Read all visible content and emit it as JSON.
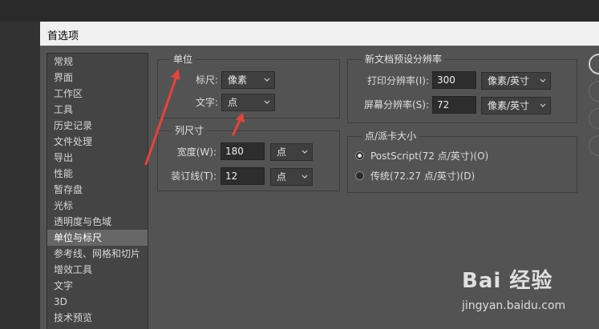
{
  "dialog": {
    "title": "首选项"
  },
  "sidebar": {
    "items": [
      {
        "label": "常规"
      },
      {
        "label": "界面"
      },
      {
        "label": "工作区"
      },
      {
        "label": "工具"
      },
      {
        "label": "历史记录"
      },
      {
        "label": "文件处理"
      },
      {
        "label": "导出"
      },
      {
        "label": "性能"
      },
      {
        "label": "暂存盘"
      },
      {
        "label": "光标"
      },
      {
        "label": "透明度与色域"
      },
      {
        "label": "单位与标尺"
      },
      {
        "label": "参考线、网格和切片"
      },
      {
        "label": "增效工具"
      },
      {
        "label": "文字"
      },
      {
        "label": "3D"
      },
      {
        "label": "技术预览"
      }
    ],
    "active_label": "单位与标尺"
  },
  "units": {
    "title": "单位",
    "ruler_label": "标尺:",
    "ruler_value": "像素",
    "type_label": "文字:",
    "type_value": "点"
  },
  "column_size": {
    "title": "列尺寸",
    "width_label": "宽度(W):",
    "width_value": "180",
    "width_unit": "点",
    "gutter_label": "装订线(T):",
    "gutter_value": "12",
    "gutter_unit": "点"
  },
  "new_doc_resolution": {
    "title": "新文档预设分辨率",
    "print_label": "打印分辨率(I):",
    "print_value": "300",
    "print_unit": "像素/英寸",
    "screen_label": "屏幕分辨率(S):",
    "screen_value": "72",
    "screen_unit": "像素/英寸"
  },
  "point_pica": {
    "title": "点/派卡大小",
    "postscript_label": "PostScript(72 点/英寸)(O)",
    "traditional_label": "传统(72.27 点/英寸)(D)",
    "selected": "postscript"
  },
  "watermark": {
    "brand": "Bai 经验",
    "url": "jingyan.baidu.com"
  },
  "colors": {
    "annotation_arrow": "#e8433a",
    "dialog_bg": "#535353"
  }
}
